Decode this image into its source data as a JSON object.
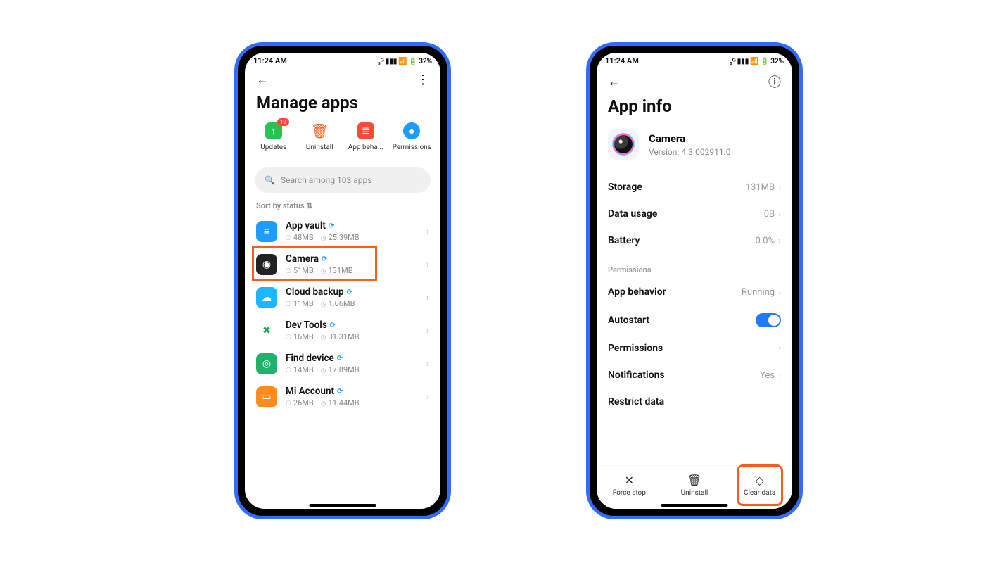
{
  "status": {
    "time": "11:24 AM",
    "battery": "32%"
  },
  "left": {
    "title": "Manage apps",
    "tools": [
      {
        "id": "updates",
        "label": "Updates",
        "badge": "19"
      },
      {
        "id": "uninstall",
        "label": "Uninstall"
      },
      {
        "id": "appbeha",
        "label": "App beha..."
      },
      {
        "id": "permissions",
        "label": "Permissions"
      }
    ],
    "search_placeholder": "Search among 103 apps",
    "sort": "Sort by status",
    "apps": [
      {
        "name": "App vault",
        "mem": "48MB",
        "disk": "25.39MB",
        "color": "#1f9cff",
        "glyph": "≡"
      },
      {
        "name": "Camera",
        "mem": "51MB",
        "disk": "131MB",
        "color": "#222",
        "glyph": "◉",
        "hl": true
      },
      {
        "name": "Cloud backup",
        "mem": "11MB",
        "disk": "1.06MB",
        "color": "#19b7ff",
        "glyph": "☁"
      },
      {
        "name": "Dev Tools",
        "mem": "16MB",
        "disk": "31.31MB",
        "color": "#fff",
        "glyph": "✖",
        "fg": "#18a85a"
      },
      {
        "name": "Find device",
        "mem": "14MB",
        "disk": "17.89MB",
        "color": "#22b06a",
        "glyph": "◎"
      },
      {
        "name": "Mi Account",
        "mem": "26MB",
        "disk": "11.44MB",
        "color": "#ff8a1e",
        "glyph": "▭"
      }
    ]
  },
  "right": {
    "title": "App info",
    "app": {
      "name": "Camera",
      "version": "Version: 4.3.002911.0"
    },
    "rows": [
      {
        "label": "Storage",
        "value": "131MB",
        "chev": true
      },
      {
        "label": "Data usage",
        "value": "0B",
        "chev": true
      },
      {
        "label": "Battery",
        "value": "0.0%",
        "chev": true
      }
    ],
    "perm_header": "Permissions",
    "rows2": [
      {
        "label": "App behavior",
        "value": "Running",
        "chev": true
      },
      {
        "label": "Autostart",
        "toggle": true
      },
      {
        "label": "Permissions",
        "chev": true
      },
      {
        "label": "Notifications",
        "value": "Yes",
        "chev": true
      },
      {
        "label": "Restrict data"
      }
    ],
    "actions": [
      {
        "id": "force",
        "label": "Force stop",
        "icon": "✕"
      },
      {
        "id": "uninstall",
        "label": "Uninstall",
        "icon": "🗑"
      },
      {
        "id": "clear",
        "label": "Clear data",
        "icon": "◇",
        "hl": true
      }
    ]
  }
}
